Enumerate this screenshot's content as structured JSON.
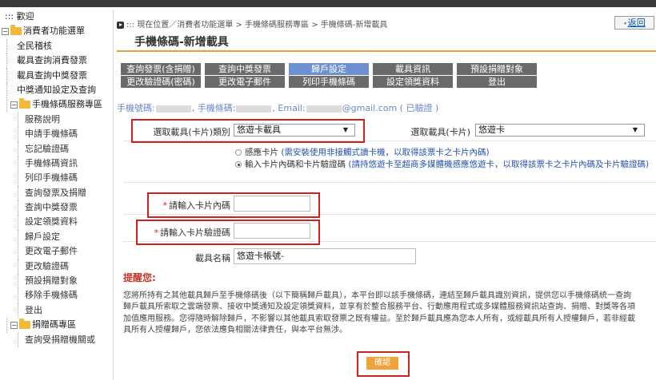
{
  "sidebar": {
    "root": "::: 歡迎",
    "folder1": "消費者功能選單",
    "items": [
      "全民稽核",
      "載具查詢消費發票",
      "載具查詢中獎發票",
      "中獎通知設定及查詢"
    ],
    "folder2": "手機條碼服務專區",
    "subitems": [
      "服務說明",
      "申請手機條碼",
      "忘記驗證碼",
      "手機條碼資訊",
      "列印手機條碼",
      "查詢發票及捐贈",
      "查詢中獎發票",
      "設定領獎資料",
      "歸戶設定",
      "更改電子郵件",
      "更改驗證碼",
      "預設捐贈對象",
      "移除手機條碼",
      "登出"
    ],
    "folder3": "捐贈碼專區",
    "folder3_items": [
      "查詢受捐贈機關或"
    ]
  },
  "header": {
    "breadcrumb": "::: 現在位置／消費者功能選單 > 手機條碼服務專區 > 手機條碼-新增載具",
    "back_label": "返回",
    "title": "手機條碼-新增載具"
  },
  "tabs": {
    "row1": [
      "查詢發票(含捐贈)",
      "查詢中獎發票",
      "歸戶設定",
      "載具資訊",
      "預設捐贈對象"
    ],
    "row2": [
      "更改驗證碼(密碼)",
      "更改電子郵件",
      "列印手機條碼",
      "設定領獎資料",
      "登出"
    ]
  },
  "user": {
    "phone_label": "手機號碼:",
    "barcode_label": ", 手機條碼:",
    "email_label": ", Email:",
    "email_suffix": "@gmail.com ( 已驗證 )"
  },
  "form": {
    "category_label": "選取載具(卡片)類別",
    "category_value": "悠遊卡載具",
    "card_label": "選取載具(卡片)",
    "card_value": "悠遊卡",
    "radio1_label": "感應卡片",
    "radio1_note": "(需安裝使用非接觸式讀卡機，以取得該票卡之卡片內碼)",
    "radio2_label": "輸入卡片內碼和卡片驗證碼",
    "radio2_note": "(請持悠遊卡至超商多媒體機感應悠遊卡，以取得該票卡之卡片內碼及卡片驗證碼)",
    "inner_code_label": "請輸入卡片內碼",
    "inner_code_value": "",
    "verify_code_label": "請輸入卡片驗證碼",
    "verify_code_value": "",
    "carrier_name_label": "載具名稱",
    "carrier_name_value": "悠遊卡帳號-"
  },
  "notice": {
    "title": "提醒您:",
    "body": "您將所持有之其他載具歸戶至手機條碼後（以下簡稱歸戶載具），本平台即以該手機條碼，連結至歸戶載具識別資訊，提供您以手機條碼統一查詢歸戶載具所索取之雲端發票、接收中獎通知及設定領獎資料，並享有於整合服務平台、行動應用程式或多媒體服務資訊站查詢、捐贈、對獎等各項加值應用服務。您得隨時解除歸戶，不影響以其他載具索取發票之既有權益。至於歸戶載具應為您本人所有，或經載具所有人授權歸戶，若非經載具所有人授權歸戶，您依法應負相關法律責任，與本平台無涉。",
    "confirm_label": "確認"
  },
  "colors": {
    "accent": "#e9a03b",
    "tab_active": "#6d90d3",
    "highlight_box": "#d4201c"
  }
}
